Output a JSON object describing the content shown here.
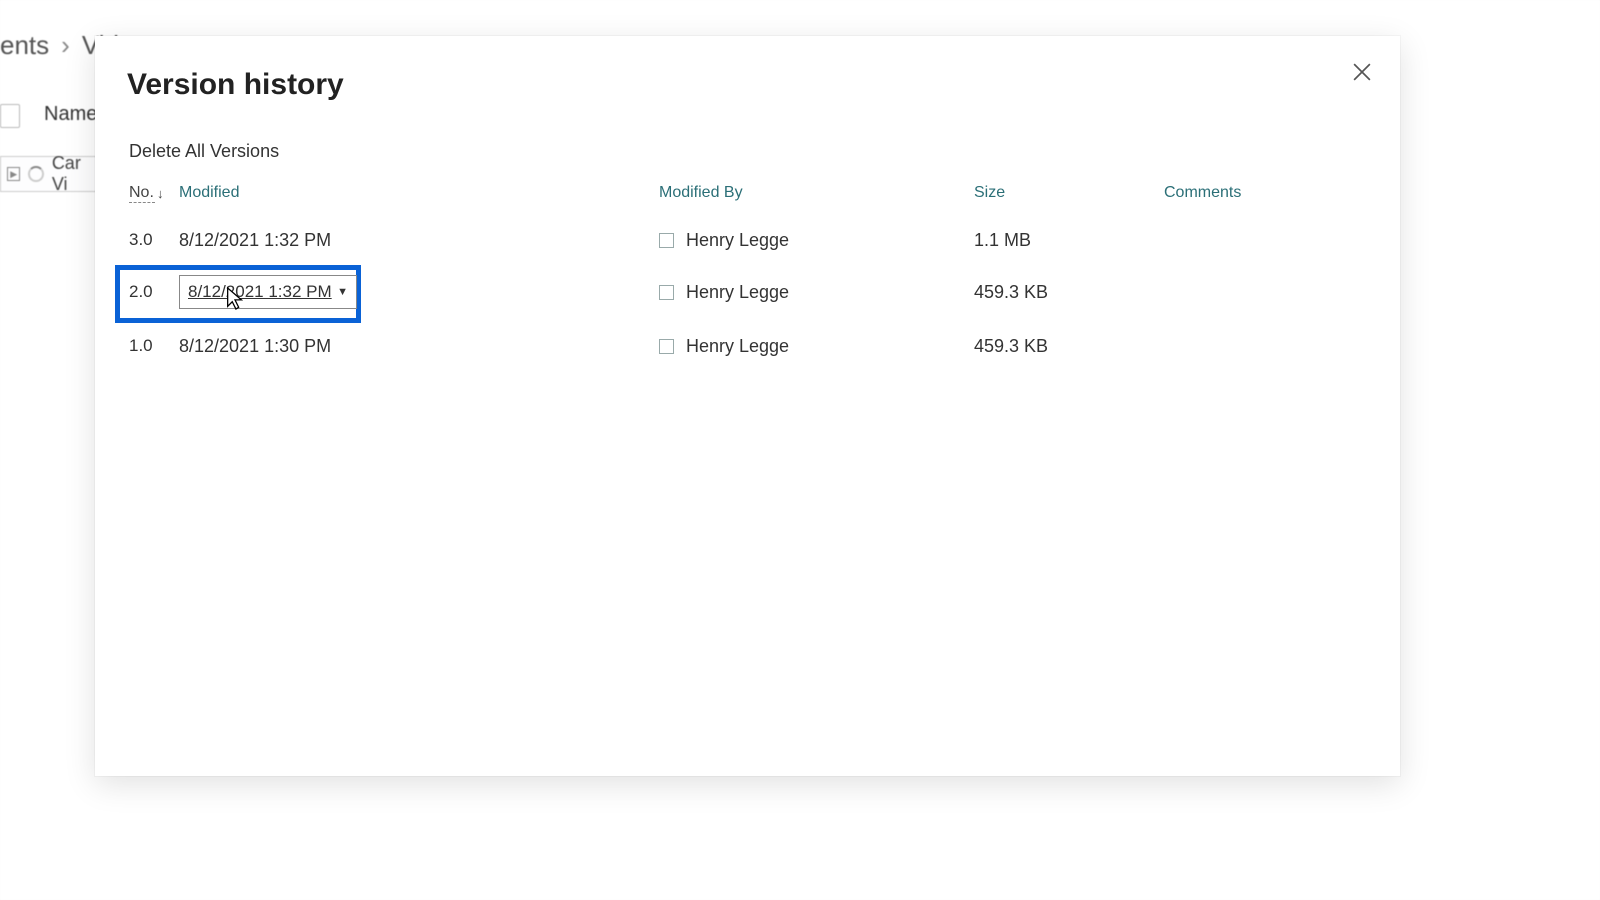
{
  "background": {
    "breadcrumb_left": "ents",
    "breadcrumb_right": "Vid",
    "column_name": "Name",
    "row_label": "Car Vi"
  },
  "dialog": {
    "title": "Version history",
    "delete_all": "Delete All Versions",
    "columns": {
      "no": "No.",
      "modified": "Modified",
      "modified_by": "Modified By",
      "size": "Size",
      "comments": "Comments"
    },
    "rows": [
      {
        "version": "3.0",
        "modified": "8/12/2021 1:32 PM",
        "modified_by": "Henry Legge",
        "size": "1.1 MB"
      },
      {
        "version": "2.0",
        "modified": "8/12/2021 1:32 PM",
        "modified_by": "Henry Legge",
        "size": "459.3 KB"
      },
      {
        "version": "1.0",
        "modified": "8/12/2021 1:30 PM",
        "modified_by": "Henry Legge",
        "size": "459.3 KB"
      }
    ]
  }
}
